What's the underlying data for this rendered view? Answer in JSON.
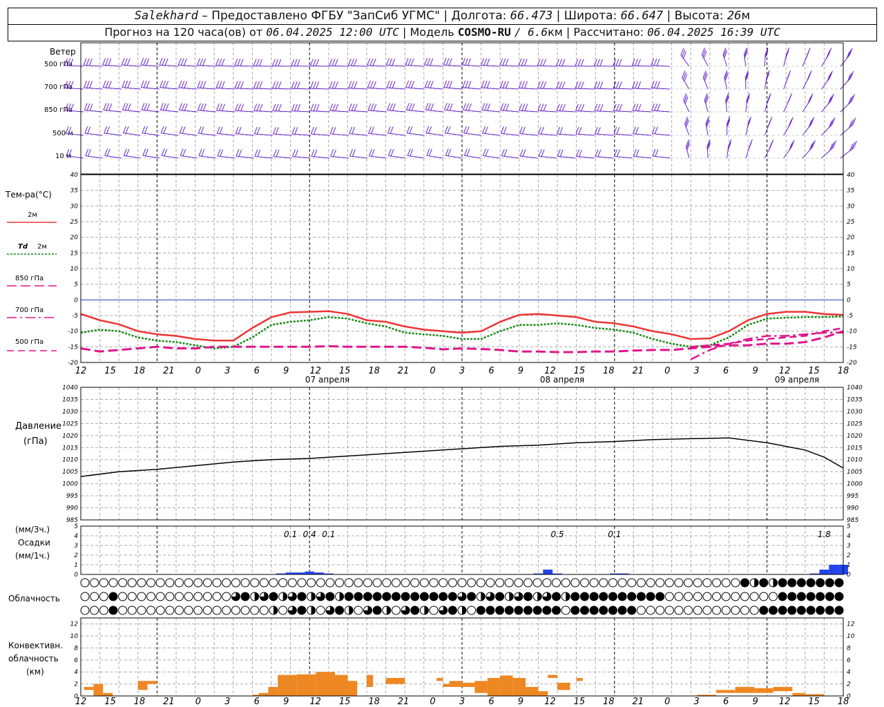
{
  "header": {
    "station": "Salekhard",
    "provider": "Предоставлено ФГБУ \"ЗапСиб УГМС\"",
    "lon_label": "Долгота:",
    "lon": "66.473",
    "lat_label": "Широта:",
    "lat": "66.647",
    "alt_label": "Высота:",
    "alt": "26",
    "alt_unit": "м",
    "forecast_label": "Прогноз на 120 часа(ов) от",
    "forecast_time": "06.04.2025 12:00 UTC",
    "model_label": "Модель",
    "model": "COSMO-RU",
    "model_res": "/ 6.6",
    "model_res_unit": "км",
    "calc_label": "Рассчитано:",
    "calc_time": "06.04.2025 16:39 UTC"
  },
  "labels": {
    "wind": "Ветер",
    "wind_levels": [
      "500 гПа",
      "700 гПа",
      "850 гПа",
      "500 м",
      "10 м"
    ],
    "temp_title": "Тем-ра(°C)",
    "t2m": "2м",
    "td2m_a": "Td",
    "td2m_b": "2м",
    "t850": "850 гПа",
    "t700": "700 гПа",
    "t500": "500 гПа",
    "pressure_a": "Давление",
    "pressure_b": "(гПа)",
    "precip_a": "(мм/3ч.)",
    "precip_b": "Осадки",
    "precip_c": "(мм/1ч.)",
    "clouds": "Облачность",
    "conv_a": "Конвективн.",
    "conv_b": "облачность",
    "conv_c": "(км)"
  },
  "colors": {
    "t2m": "#ee3333",
    "td2m": "#118811",
    "t850": "#e0148c",
    "t700": "#e0148c",
    "t500": "#e0148c",
    "wind": "#6622cc",
    "precip": "#2244ee",
    "conv": "#ee8822",
    "pressure": "#000000",
    "zero_line": "#3344cc"
  },
  "chart_data": [
    {
      "type": "line",
      "name": "temperature",
      "x_hours": [
        0,
        3,
        6,
        9,
        12,
        15,
        18,
        21,
        24,
        27,
        30,
        33,
        36,
        39,
        42,
        45,
        48,
        51,
        54,
        57,
        60,
        63,
        66,
        69,
        72,
        75,
        78,
        81,
        84,
        87,
        90,
        93,
        96,
        99,
        102,
        105,
        108,
        111,
        114,
        117,
        120
      ],
      "x_tick_labels": [
        "12",
        "15",
        "18",
        "21",
        "0",
        "3",
        "6",
        "9",
        "12",
        "15",
        "18",
        "21",
        "0",
        "3",
        "6",
        "9",
        "12",
        "15",
        "18",
        "21",
        "0",
        "3",
        "6",
        "9",
        "12",
        "15",
        "18"
      ],
      "day_labels": [
        "07 апреля",
        "08 апреля",
        "09 апреля"
      ],
      "ylim": [
        -20,
        40
      ],
      "series": [
        {
          "name": "2м",
          "key": "t2m",
          "values": [
            -4.5,
            -6.5,
            -7.8,
            -10,
            -11,
            -11.5,
            -12.5,
            -13,
            -13,
            -9,
            -5.5,
            -4,
            -3.8,
            -3.6,
            -4.5,
            -6.5,
            -7,
            -8.5,
            -9.5,
            -10,
            -10.5,
            -10,
            -7,
            -4.8,
            -4.5,
            -5,
            -5.5,
            -7,
            -7.5,
            -8.5,
            -10,
            -11,
            -12.5,
            -12.3,
            -10,
            -6.5,
            -4.5,
            -3.8,
            -3.8,
            -4.5,
            -4.8
          ]
        },
        {
          "name": "Td 2м",
          "key": "td2m",
          "values": [
            -10.5,
            -9.5,
            -10,
            -12,
            -13,
            -13.5,
            -14.5,
            -15.5,
            -15,
            -12,
            -8,
            -7,
            -6.5,
            -5.5,
            -6,
            -7.5,
            -8.5,
            -10.5,
            -11,
            -11.5,
            -12.5,
            -12.5,
            -10,
            -8,
            -8,
            -7.5,
            -8,
            -9,
            -9.5,
            -10.5,
            -12.5,
            -14,
            -15,
            -14.5,
            -12,
            -8,
            -6,
            -5.7,
            -5.5,
            -5.5,
            -5.3
          ]
        },
        {
          "name": "850 гПа",
          "key": "t850",
          "values": [
            -15.5,
            -16.5,
            -16,
            -15.5,
            -15,
            -15.5,
            -15.5,
            -15,
            -15,
            -15,
            -15,
            -15,
            -15,
            -14.8,
            -15,
            -15,
            -15,
            -15,
            -15.3,
            -15.8,
            -15.5,
            -15.7,
            -16,
            -16.5,
            -16.5,
            -16.7,
            -16.7,
            -16.5,
            -16.5,
            -16.2,
            -16,
            -16,
            -15.5,
            -15,
            -14.5,
            -14.5,
            -14,
            -14,
            -13.5,
            -12,
            -10
          ]
        },
        {
          "name": "700 гПа",
          "key": "t700",
          "values": [
            null,
            null,
            null,
            null,
            null,
            null,
            null,
            null,
            null,
            null,
            null,
            null,
            null,
            null,
            null,
            null,
            null,
            null,
            null,
            null,
            null,
            null,
            null,
            null,
            null,
            null,
            null,
            null,
            null,
            null,
            null,
            null,
            -19,
            -16,
            -14,
            -12.5,
            -11.5,
            -11.5,
            -11,
            -10.5,
            -10.5
          ]
        },
        {
          "name": "500 гПа",
          "key": "t500",
          "values": [
            null,
            null,
            null,
            null,
            null,
            null,
            null,
            null,
            null,
            null,
            null,
            null,
            null,
            null,
            null,
            null,
            null,
            null,
            null,
            null,
            null,
            null,
            null,
            null,
            null,
            null,
            null,
            null,
            null,
            null,
            null,
            null,
            -15,
            -14.5,
            -14,
            -13,
            -12.5,
            -12,
            -11.5,
            -10,
            -9
          ]
        }
      ]
    },
    {
      "type": "line",
      "name": "pressure",
      "x_hours": [
        0,
        6,
        12,
        18,
        24,
        30,
        36,
        42,
        48,
        54,
        60,
        66,
        72,
        78,
        84,
        90,
        96,
        102,
        108,
        114,
        117,
        120
      ],
      "ylim": [
        985,
        1040
      ],
      "values": [
        1003,
        1005,
        1006,
        1007.5,
        1009,
        1010,
        1010.5,
        1011.5,
        1012.5,
        1013.5,
        1014.5,
        1015.5,
        1016,
        1017,
        1017.5,
        1018.3,
        1018.7,
        1019,
        1017,
        1014,
        1011,
        1006.5
      ]
    },
    {
      "type": "bar",
      "name": "precipitation",
      "x_hours": [
        97.5,
        99,
        100.5,
        102,
        103.5,
        105,
        106.5,
        108,
        109.5,
        111,
        112.5,
        114,
        115.5,
        117,
        118.5,
        120,
        31.5,
        33,
        34.5,
        36,
        37.5,
        39,
        72,
        73.5,
        75,
        84,
        85.5
      ],
      "mm_per_hour": [
        0,
        0,
        0,
        0,
        0,
        0,
        0,
        0,
        0,
        0,
        0,
        0,
        0.1,
        0.5,
        1.0,
        1.0,
        0.1,
        0.2,
        0.2,
        0.3,
        0.2,
        0.1,
        0.1,
        0.5,
        0.1,
        0.1,
        0.1
      ],
      "ylim": [
        0,
        5
      ],
      "totals_3h": [
        {
          "hour": 33,
          "label": "0.1"
        },
        {
          "hour": 36,
          "label": "0.4"
        },
        {
          "hour": 39,
          "label": "0.1"
        },
        {
          "hour": 75,
          "label": "0.5"
        },
        {
          "hour": 84,
          "label": "0.1"
        },
        {
          "hour": 117,
          "label": "1.8"
        }
      ]
    },
    {
      "type": "bar",
      "name": "convective_clouds",
      "ylim": [
        0,
        13
      ],
      "blocks": [
        {
          "h0": 0.5,
          "h1": 2,
          "base": 1,
          "top": 1.5
        },
        {
          "h0": 2,
          "h1": 3.5,
          "base": 0,
          "top": 2
        },
        {
          "h0": 3.5,
          "h1": 5,
          "base": 0,
          "top": 0.5
        },
        {
          "h0": 9,
          "h1": 10.5,
          "base": 1,
          "top": 2.5
        },
        {
          "h0": 10.5,
          "h1": 12,
          "base": 2,
          "top": 2.5
        },
        {
          "h0": 27,
          "h1": 28,
          "base": 0,
          "top": 0.2
        },
        {
          "h0": 28,
          "h1": 29.5,
          "base": 0,
          "top": 0.5
        },
        {
          "h0": 29.5,
          "h1": 31,
          "base": 0,
          "top": 1.5
        },
        {
          "h0": 31,
          "h1": 34,
          "base": 0,
          "top": 3.5
        },
        {
          "h0": 34,
          "h1": 37,
          "base": 0,
          "top": 3.6
        },
        {
          "h0": 37,
          "h1": 40,
          "base": 0,
          "top": 4
        },
        {
          "h0": 40,
          "h1": 42,
          "base": 0,
          "top": 3.5
        },
        {
          "h0": 42,
          "h1": 43.5,
          "base": 0,
          "top": 2.5
        },
        {
          "h0": 45,
          "h1": 46,
          "base": 1.5,
          "top": 3.5
        },
        {
          "h0": 48,
          "h1": 51,
          "base": 2,
          "top": 3
        },
        {
          "h0": 56,
          "h1": 57,
          "base": 2.5,
          "top": 3
        },
        {
          "h0": 57,
          "h1": 58,
          "base": 1.5,
          "top": 2
        },
        {
          "h0": 58,
          "h1": 60,
          "base": 1.5,
          "top": 2.5
        },
        {
          "h0": 60,
          "h1": 62,
          "base": 1.5,
          "top": 2.2
        },
        {
          "h0": 62,
          "h1": 64,
          "base": 0.5,
          "top": 2.5
        },
        {
          "h0": 64,
          "h1": 66,
          "base": 0,
          "top": 3
        },
        {
          "h0": 66,
          "h1": 68,
          "base": 0,
          "top": 3.4
        },
        {
          "h0": 68,
          "h1": 70,
          "base": 0,
          "top": 3
        },
        {
          "h0": 70,
          "h1": 72,
          "base": 0,
          "top": 1.5
        },
        {
          "h0": 72,
          "h1": 73.5,
          "base": 0,
          "top": 0.8
        },
        {
          "h0": 73.5,
          "h1": 75,
          "base": 3,
          "top": 3.5
        },
        {
          "h0": 75,
          "h1": 77,
          "base": 1,
          "top": 2.2
        },
        {
          "h0": 78,
          "h1": 79,
          "base": 2.5,
          "top": 3
        },
        {
          "h0": 97,
          "h1": 100,
          "base": 0,
          "top": 0.2
        },
        {
          "h0": 100,
          "h1": 103,
          "base": 0.5,
          "top": 1
        },
        {
          "h0": 103,
          "h1": 106,
          "base": 0.5,
          "top": 1.5
        },
        {
          "h0": 106,
          "h1": 109,
          "base": 0.5,
          "top": 1.3
        },
        {
          "h0": 109,
          "h1": 112,
          "base": 0.8,
          "top": 1.5
        },
        {
          "h0": 112,
          "h1": 114,
          "base": 0,
          "top": 0.5
        },
        {
          "h0": 114,
          "h1": 117,
          "base": 0,
          "top": 0.3
        }
      ]
    }
  ]
}
